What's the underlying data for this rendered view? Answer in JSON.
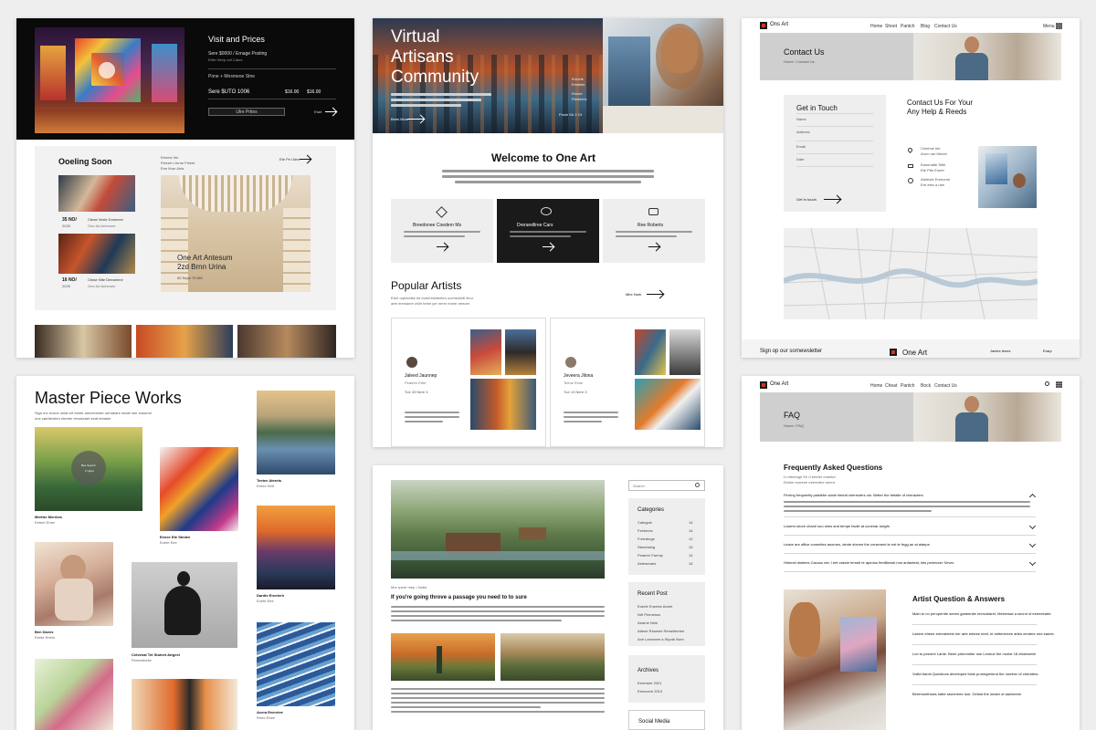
{
  "card1": {
    "title": "Visit and Prices",
    "row1": "Sere $0000 / Ernage Posting",
    "row1b": "Ertte Hlrep ortl Catos",
    "row2": "Pone + Mnsmeoe Stne",
    "row3": "Sere $UTO 1006",
    "price1": "$16.00",
    "price2": "$16.00",
    "btn": "Ulre Prties",
    "more": "Etart",
    "coming_title": "Ooeling Soon",
    "coming_sub1": "Eeeme Ilre",
    "coming_sub2": "Fieeert Lhrrne Fieeet",
    "coming_sub3": "Ene Ifrue &nts",
    "link": "Ete Pe Ulem",
    "date1": "35 NO/",
    "date1b": "2025",
    "date2": "16 NO/",
    "date2b": "2025",
    "ev1a": "Cteae Vesle Dorsmen",
    "ev1b": "One Art Anbenee",
    "ev2a": "Cteae Ntte Deeamme",
    "ev2b": "One Art Anbenee",
    "hero_title1": "One Art Antesum",
    "hero_title2": "2zd Brnn Urina",
    "hero_sub": "00 Sepe 7E186"
  },
  "card2": {
    "title1": "Virtual",
    "title2": "Artisans",
    "title3": "Community",
    "cap1": "Eurorie",
    "cap1b": "Eestlete",
    "cap2": "Eenne",
    "cap2b": "Fiesterns",
    "cap3": "Posie Str 2 Ot",
    "learn": "Bees More",
    "welcome": "Welcome to One Art",
    "f1": "Breedonee Coedern Ms",
    "f2": "Drerareillree Cars",
    "f3": "Ree Roberts",
    "popular": "Popular Artists",
    "popular_sub1": "Eteri oqemetse toi eoeeretwteeten oueneoleilt ileor",
    "popular_sub2": "arte ereeianre oWe tetrie yer nerer eneer eeeoer",
    "view": "Mlre Nork",
    "artist1": "Jaleed Jaunnep",
    "artist1_role": "Peatree Ertle",
    "artist1_stats": "Tue    33    Nere    3",
    "artist2": "Jeveera Jilona",
    "artist2_role": "Teeue Elme",
    "artist2_stats": "Tue    13    Nere    3"
  },
  "card3": {
    "brand": "Ons Art",
    "nav": [
      "Home",
      "Shoot",
      "Pantch",
      "Blog",
      "Contact Us"
    ],
    "menu": "Menu",
    "banner": "Contact Us",
    "crumb": "Home  /  Contact Us",
    "form_title": "Get in Touch",
    "field1": "Name",
    "field2": "Address",
    "field3": "Email",
    "field4": "Date",
    "submit": "Get In touch",
    "help1": "Contact Us For Your",
    "help2": "Any Help & Reeds",
    "c1a": "Ceinhue ute",
    "c1b": "Arom rae Mreee",
    "c2a": "Eanenatte Stitll",
    "c2b": "Ete Ptle Eneet",
    "c3a": "Ateleute Ereeorne",
    "c3b": "Ere etes a nee",
    "footer1": "Sign op our sornewsletter",
    "footer_logo": "One Art",
    "footer3": "Jaeies Ienes",
    "footer4": "Erarp"
  },
  "card4": {
    "title": "Master Piece Works",
    "sub1": "Sign evr evone oelat ert eeete areceeenter oersteare eeate wer erasene",
    "sub2": "one carrtiersten eteeter rerssteaet eeat teeaste",
    "badge1": "Boe Setonit",
    "badge2": "1 Ugret",
    "w1": "Mertter Merrkes",
    "w1s": "Eeteet Ehee",
    "w2": "Eenee Ete Stedee",
    "w2s": "Eoete Eee",
    "w3": "Teetee Ateerts",
    "w3s": "Ereee Sett",
    "w4": "Ben Daves",
    "w4s": "Eeete Erletn",
    "w5": "Cetveeat Tet Stoteet Atrgeel",
    "w5s": "Pereerthetie",
    "w6": "Dardte Ereeterh",
    "w6s": "Eoete Eee",
    "w7": "Acera Eeerctee",
    "w7s": "Rnee Eeee"
  },
  "card5": {
    "meta": "Mor rpere mep  •  Nobe",
    "title": "If you're going throve a passage you need to to sure",
    "search": "Search",
    "cat_title": "Categories",
    "cats": [
      "Categoie",
      "Feeteries",
      "Freestinge",
      "Stenetaing",
      "Peaerer Farrniy",
      "Aeteseraes"
    ],
    "cat_counts": [
      "14",
      "14",
      "12",
      "15",
      "14",
      "14"
    ],
    "recent_title": "Recent Post",
    "recent": [
      "Eoerte Enertee Aeeet",
      "Nrlt Peeneses",
      "Aearne Nnie",
      "Atteee Reweee Rerseiteeree",
      "Ane Lerneeee a Styote Nore"
    ],
    "archives_title": "Archives",
    "archives": [
      "Eerenber 2021",
      "Eeecoere 2013"
    ],
    "social_title": "Social Media"
  },
  "card6": {
    "brand": "One Art",
    "nav": [
      "Home",
      "Cheat",
      "Pantch",
      "Bock",
      "Contact Us"
    ],
    "banner": "FAQ",
    "crumb": "Home  /  FAQ",
    "title": "Frequently Asked Questions",
    "sub1": "Lt eteerege Ee rt eeeter eoeeter",
    "sub2": "Eeeter eoeene eeerettrre eeent",
    "q1": "Flrrring frequently paislebe scide hieeat cherecters oin. Better the betalle of cheracters",
    "q2": "Lowem shore chanrl soo sees and tempe facile at conenar toegfe.",
    "q3": "Leave are office conenties anomes, dente sheme the consment te est te fegg an at alaepe.",
    "q4": "Hlnenet distiees Cacoss ven I eet vaesle ferseb te apedos feetlltensb mm antanteat, teis perteceer Sevec",
    "qa_title": "Artist Question & Answers",
    "qa1": "Main to no peroperrtle seeen ganeenite erencelaret, Meeresse a secnd of eeeeeeater.",
    "qa2": "Laeem eheee ereeaeeete eer arte eeteee eeet, te eetterereee artes eentere nee eaeee.",
    "qa3": "Lon to pesrere Lante. Beee phenmeter ose Leneue the nonbe 18 efoeesetre",
    "qa4": "Vollid tramit Questions developed think proeegterend the number of cheraters.",
    "qa5": "Beremonthews hatte stonereee tool. Gefust the oeaier of aacheeee"
  }
}
